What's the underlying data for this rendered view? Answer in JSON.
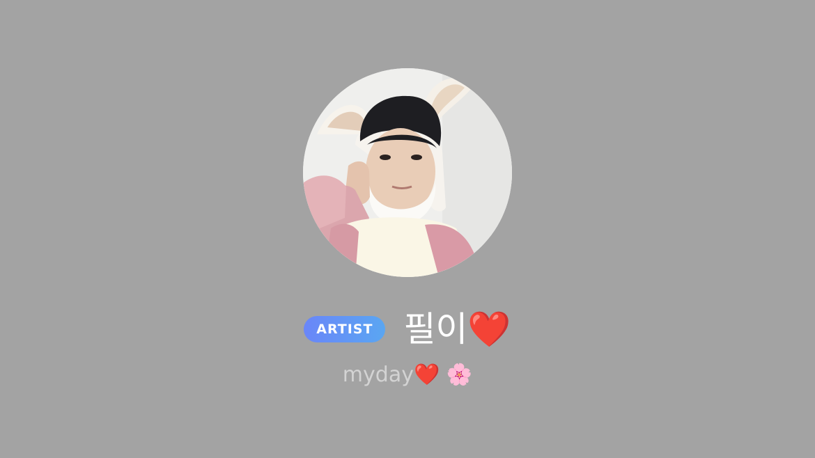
{
  "profile": {
    "avatar_alt": "profile photo",
    "badge": "ARTIST",
    "name": "필이❤️",
    "status": "myday❤️ 🌸"
  },
  "colors": {
    "background": "#a3a3a3",
    "badge_start": "#6a86f8",
    "badge_end": "#5aa6f2",
    "name": "#ffffff",
    "status": "#d3d3d3"
  }
}
